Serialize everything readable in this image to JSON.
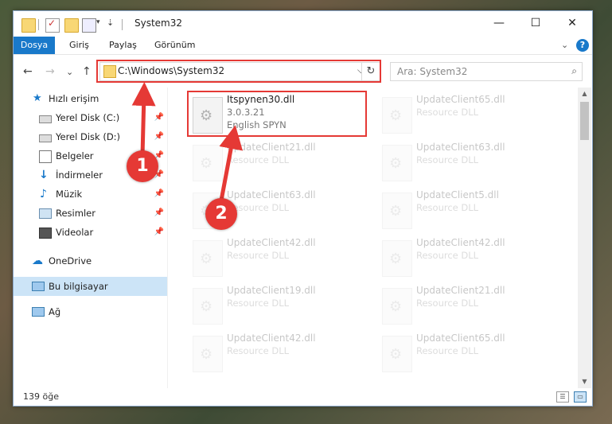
{
  "window": {
    "title": "System32",
    "controls": {
      "minimize": "—",
      "maximize": "☐",
      "close": "✕"
    }
  },
  "ribbon": {
    "tabs": [
      "Dosya",
      "Giriş",
      "Paylaş",
      "Görünüm"
    ],
    "expand_icon": "chevron-down-icon",
    "help": "?"
  },
  "address": {
    "path": "C:\\Windows\\System32",
    "dropdown": "⌵",
    "refresh": "↻"
  },
  "search": {
    "placeholder": "Ara: System32",
    "icon": "⌕"
  },
  "nav": {
    "back": "←",
    "forward": "→",
    "recent": "⌄",
    "up": "↑"
  },
  "sidebar": {
    "items": [
      {
        "label": "Hızlı erişim",
        "icon": "star-icon"
      },
      {
        "label": "Yerel Disk (C:)",
        "icon": "drive-icon",
        "pinned": true
      },
      {
        "label": "Yerel Disk (D:)",
        "icon": "drive-icon",
        "pinned": true
      },
      {
        "label": "Belgeler",
        "icon": "documents-icon",
        "pinned": true
      },
      {
        "label": "İndirmeler",
        "icon": "downloads-icon",
        "pinned": true
      },
      {
        "label": "Müzik",
        "icon": "music-icon",
        "pinned": true
      },
      {
        "label": "Resimler",
        "icon": "pictures-icon",
        "pinned": true
      },
      {
        "label": "Videolar",
        "icon": "videos-icon",
        "pinned": true
      },
      {
        "label": "OneDrive",
        "icon": "cloud-icon"
      },
      {
        "label": "Bu bilgisayar",
        "icon": "computer-icon",
        "selected": true
      },
      {
        "label": "Ağ",
        "icon": "network-icon"
      }
    ],
    "pin_glyph": "📌"
  },
  "files": [
    {
      "name": "Itspynen30.dll",
      "line2": "3.0.3.21",
      "line3": "English SPYN",
      "highlighted": true
    },
    {
      "name": "UpdateClient65.dll",
      "line2": "Resource DLL"
    },
    {
      "name": "UpdateClient21.dll",
      "line2": "Resource DLL"
    },
    {
      "name": "UpdateClient63.dll",
      "line2": "Resource DLL"
    },
    {
      "name": "UpdateClient63.dll",
      "line2": "Resource DLL"
    },
    {
      "name": "UpdateClient5.dll",
      "line2": "Resource DLL"
    },
    {
      "name": "UpdateClient42.dll",
      "line2": "Resource DLL"
    },
    {
      "name": "UpdateClient42.dll",
      "line2": "Resource DLL"
    },
    {
      "name": "UpdateClient19.dll",
      "line2": "Resource DLL"
    },
    {
      "name": "UpdateClient21.dll",
      "line2": "Resource DLL"
    },
    {
      "name": "UpdateClient42.dll",
      "line2": "Resource DLL"
    },
    {
      "name": "UpdateClient65.dll",
      "line2": "Resource DLL"
    }
  ],
  "status": {
    "count": "139 öğe"
  },
  "annotations": {
    "marker1": "1",
    "marker2": "2",
    "color": "#e53935"
  }
}
